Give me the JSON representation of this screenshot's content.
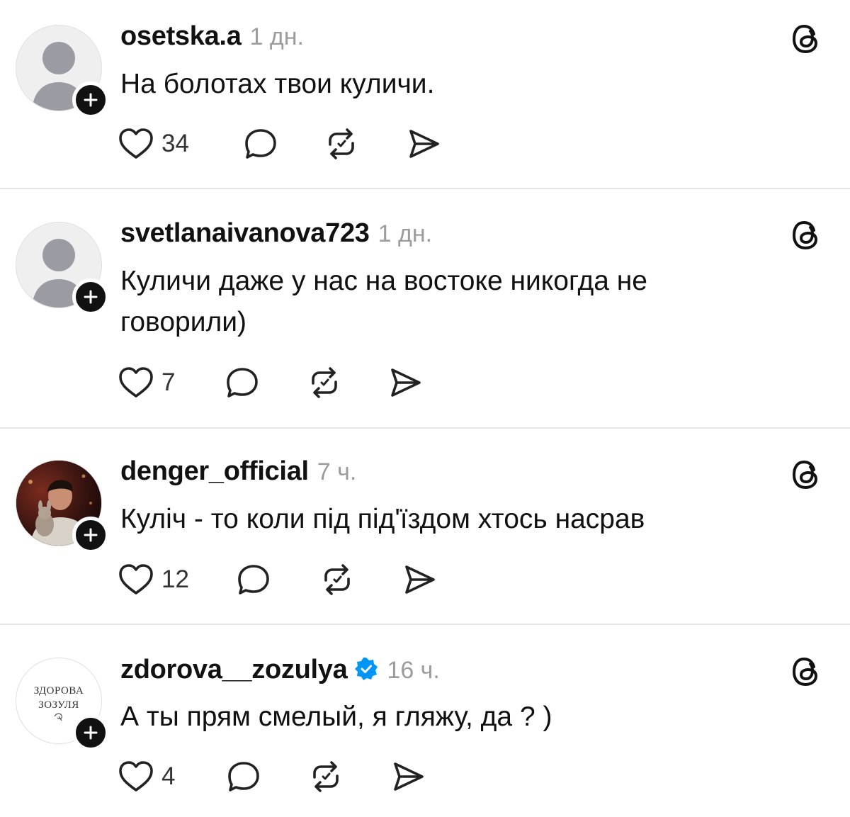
{
  "posts": [
    {
      "username": "osetska.a",
      "time": "1 дн.",
      "text": "На болотах твои куличи.",
      "likes": "34",
      "avatar": "default-avatar",
      "verified": false
    },
    {
      "username": "svetlanaivanova723",
      "time": "1 дн.",
      "text": "Куличи даже у нас на востоке никогда не говорили)",
      "likes": "7",
      "avatar": "default-avatar",
      "verified": false
    },
    {
      "username": "denger_official",
      "time": "7 ч.",
      "text": "Куліч - то коли під під'їздом хтось насрав",
      "likes": "12",
      "avatar": "photo-avatar",
      "verified": false
    },
    {
      "username": "zdorova__zozulya",
      "time": "16 ч.",
      "text": "А ты прям смелый, я гляжу, да ? )",
      "likes": "4",
      "avatar": "logo-avatar",
      "avatar_logo_text": [
        "ЗДОРОВА",
        "ЗОЗУЛЯ"
      ],
      "verified": true
    }
  ],
  "icons": {
    "like": "heart-icon",
    "reply": "comment-bubble-icon",
    "repost": "repost-icon",
    "share": "send-icon",
    "platform": "threads-logo-icon",
    "follow": "plus-icon"
  },
  "colors": {
    "text": "#111111",
    "muted": "#9c9c9c",
    "verified": "#0095f6",
    "divider": "#e6e6e6"
  }
}
